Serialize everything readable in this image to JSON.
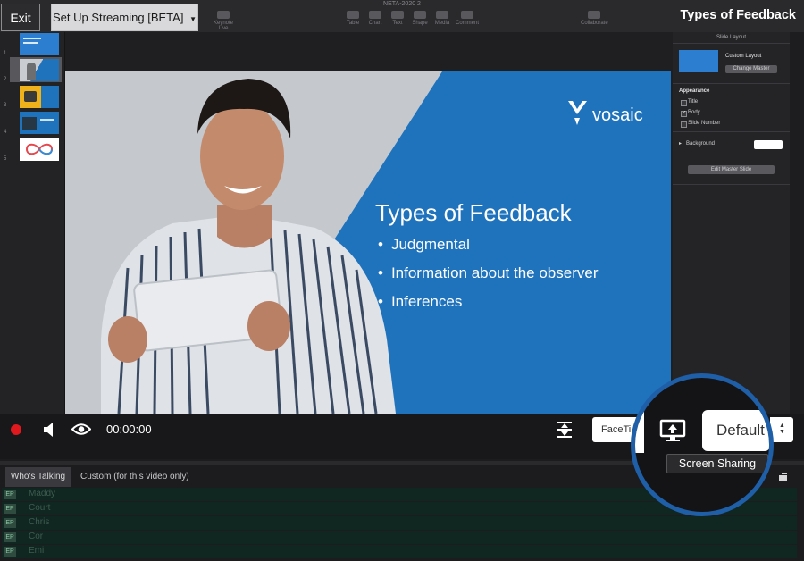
{
  "toolbar": {
    "doc_title": "NETA-2020 2",
    "tools": [
      {
        "label": "Keynote Live",
        "icon": "keynote-live-icon"
      },
      {
        "label": "Table",
        "icon": "table-icon"
      },
      {
        "label": "Chart",
        "icon": "chart-icon"
      },
      {
        "label": "Text",
        "icon": "text-icon"
      },
      {
        "label": "Shape",
        "icon": "shape-icon"
      },
      {
        "label": "Media",
        "icon": "media-icon"
      },
      {
        "label": "Comment",
        "icon": "comment-icon"
      },
      {
        "label": "Collaborate",
        "icon": "collaborate-icon"
      }
    ]
  },
  "overlay": {
    "exit_label": "Exit",
    "streaming_label": "Set Up Streaming [BETA]",
    "title": "Types of Feedback"
  },
  "thumbnails": {
    "numbers": [
      "1",
      "2",
      "3",
      "4",
      "5"
    ],
    "selected": "2"
  },
  "slide": {
    "title": "Types of Feedback",
    "bullets": [
      "Judgmental",
      "Information about the observer",
      "Inferences"
    ],
    "logo_text": "vosaic",
    "brand_color": "#1f73bd"
  },
  "inspector": {
    "header": "Slide Layout",
    "layout_name": "Custom Layout",
    "change_master": "Change Master",
    "appearance_label": "Appearance",
    "options": [
      {
        "label": "Title",
        "checked": false
      },
      {
        "label": "Body",
        "checked": true
      },
      {
        "label": "Slide Number",
        "checked": false
      }
    ],
    "background_label": "Background",
    "edit_master": "Edit Master Slide"
  },
  "controls": {
    "timer": "00:00:00",
    "facetime_label": "FaceTi",
    "default_label": "Default –",
    "tooltip": "Screen Sharing",
    "record_color": "#e0191f"
  },
  "talking": {
    "tab_whos": "Who's Talking",
    "tab_custom": "Custom (for this video only)",
    "rows": [
      {
        "badge": "EP",
        "name": "Maddy"
      },
      {
        "badge": "EP",
        "name": "Court"
      },
      {
        "badge": "EP",
        "name": "Chris"
      },
      {
        "badge": "EP",
        "name": "Cor"
      },
      {
        "badge": "EP",
        "name": "Emi"
      }
    ]
  }
}
